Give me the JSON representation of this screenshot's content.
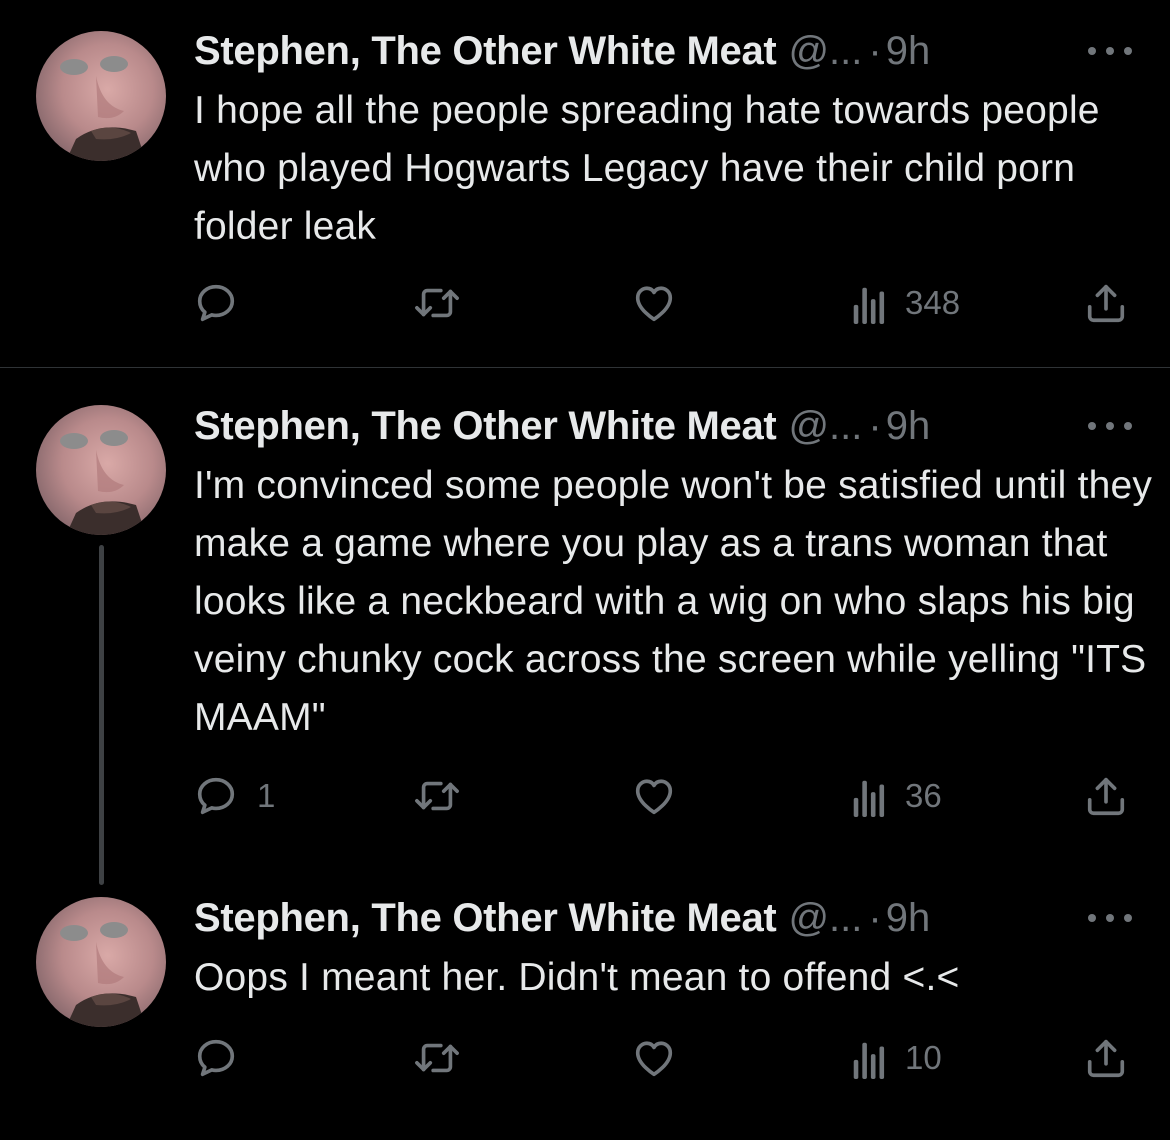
{
  "colors": {
    "background": "#000000",
    "primary_text": "#e7e9ea",
    "secondary_text": "#71767b",
    "divider": "#2f3336",
    "thread_line": "#3e4144"
  },
  "tweets": [
    {
      "author_name": "Stephen, The Other White Meat",
      "handle": "@...",
      "separator": "·",
      "time": "9h",
      "text": "I hope all the people spreading hate towards people who played Hogwarts Legacy have their child porn folder leak",
      "replies": "",
      "views": "348",
      "icons": [
        "reply-icon",
        "retweet-icon",
        "like-icon",
        "views-icon",
        "share-icon",
        "more-icon"
      ]
    },
    {
      "author_name": "Stephen, The Other White Meat",
      "handle": "@...",
      "separator": "·",
      "time": "9h",
      "text": "I'm convinced some people won't be satisfied until they make a game where you play as a trans woman that looks like a neckbeard with a wig on who slaps his big veiny chunky cock across the screen while yelling \"ITS MAAM\"",
      "replies": "1",
      "views": "36",
      "icons": [
        "reply-icon",
        "retweet-icon",
        "like-icon",
        "views-icon",
        "share-icon",
        "more-icon"
      ]
    },
    {
      "author_name": "Stephen, The Other White Meat",
      "handle": "@...",
      "separator": "·",
      "time": "9h",
      "text": "Oops I meant her. Didn't mean to offend <.<",
      "replies": "",
      "views": "10",
      "icons": [
        "reply-icon",
        "retweet-icon",
        "like-icon",
        "views-icon",
        "share-icon",
        "more-icon"
      ]
    }
  ]
}
